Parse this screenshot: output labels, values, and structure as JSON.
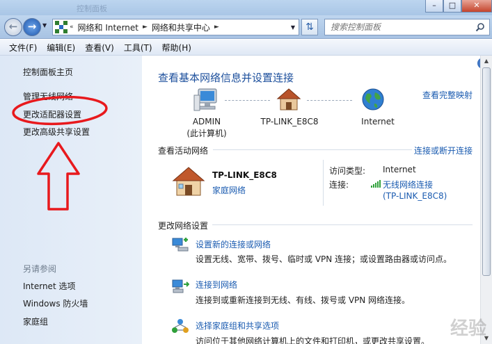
{
  "window": {
    "title_blur": "控制面板",
    "min": "–",
    "max": "□",
    "close": "✕"
  },
  "address": {
    "prefix": "«",
    "crumbs": [
      "网络和 Internet",
      "网络和共享中心"
    ],
    "search_placeholder": "搜索控制面板"
  },
  "menu": [
    "文件(F)",
    "编辑(E)",
    "查看(V)",
    "工具(T)",
    "帮助(H)"
  ],
  "sidebar": {
    "home": "控制面板主页",
    "items": [
      "管理无线网络",
      "更改适配器设置",
      "更改高级共享设置"
    ],
    "see_also_heading": "另请参阅",
    "see_also": [
      "Internet 选项",
      "Windows 防火墙",
      "家庭组"
    ]
  },
  "main": {
    "title": "查看基本网络信息并设置连接",
    "full_map_link": "查看完整映射",
    "nodes": {
      "computer": "ADMIN",
      "computer_sub": "(此计算机)",
      "router": "TP-LINK_E8C8",
      "internet": "Internet"
    },
    "active_networks": {
      "heading": "查看活动网络",
      "connect_link": "连接或断开连接",
      "network_name": "TP-LINK_E8C8",
      "network_type": "家庭网络",
      "access_type_label": "访问类型:",
      "access_type_value": "Internet",
      "connection_label": "连接:",
      "connection_link": "无线网络连接",
      "connection_ssid": "(TP-LINK_E8C8)"
    },
    "change_settings": {
      "heading": "更改网络设置",
      "tasks": [
        {
          "link": "设置新的连接或网络",
          "desc": "设置无线、宽带、拨号、临时或 VPN 连接；或设置路由器或访问点。"
        },
        {
          "link": "连接到网络",
          "desc": "连接到或重新连接到无线、有线、拨号或 VPN 网络连接。"
        },
        {
          "link": "选择家庭组和共享选项",
          "desc": "访问位于其他网络计算机上的文件和打印机，或更改共享设置。"
        }
      ]
    }
  },
  "watermark": "经验",
  "colors": {
    "link": "#1a5bb0",
    "title": "#1c4f9c",
    "annotation": "#e8191d",
    "sidebar_bg": "#e3ecf8"
  }
}
